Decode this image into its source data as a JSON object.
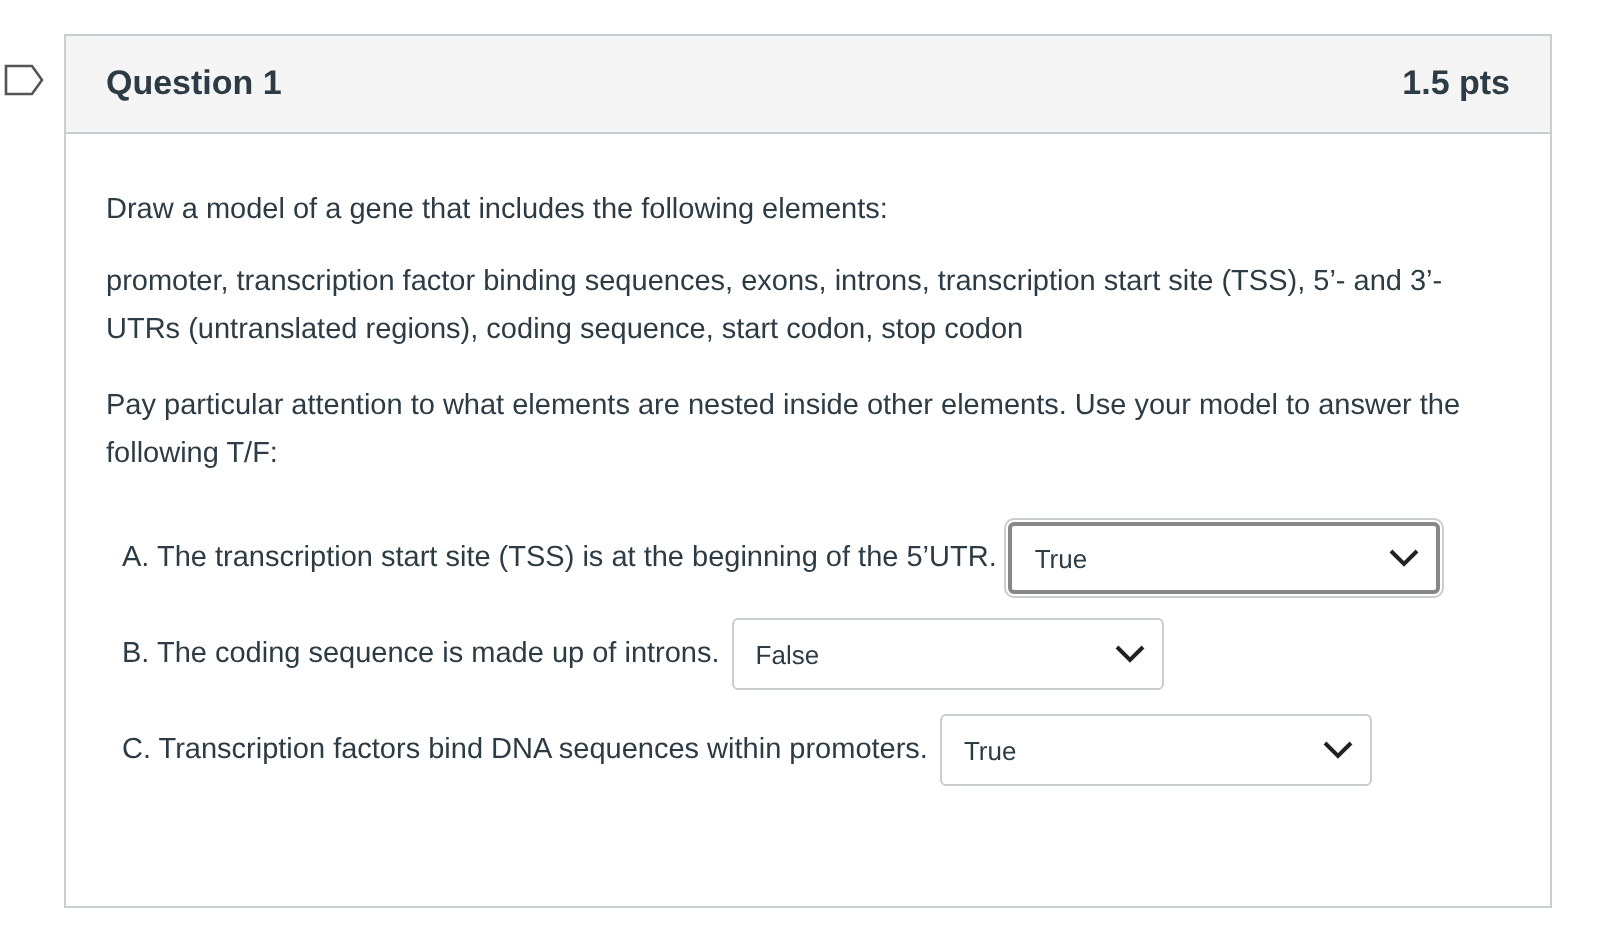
{
  "question": {
    "title": "Question 1",
    "points": "1.5 pts",
    "bookmarked": false
  },
  "paragraphs": [
    "Draw a model of a gene that includes the following elements:",
    "promoter, transcription factor binding sequences, exons, introns, transcription start site (TSS), 5’- and 3’-UTRs (untranslated regions), coding sequence, start codon, stop codon",
    "Pay particular attention to what elements are nested inside other elements. Use your model to answer the following T/F:"
  ],
  "items": [
    {
      "statement": "A. The transcription start site (TSS) is at the beginning of the 5’UTR.",
      "answer": "True",
      "focused": true
    },
    {
      "statement": "B. The coding sequence is made up of introns.",
      "answer": "False",
      "focused": false
    },
    {
      "statement": "C. Transcription factors bind DNA sequences within promoters.",
      "answer": "True",
      "focused": false
    }
  ]
}
